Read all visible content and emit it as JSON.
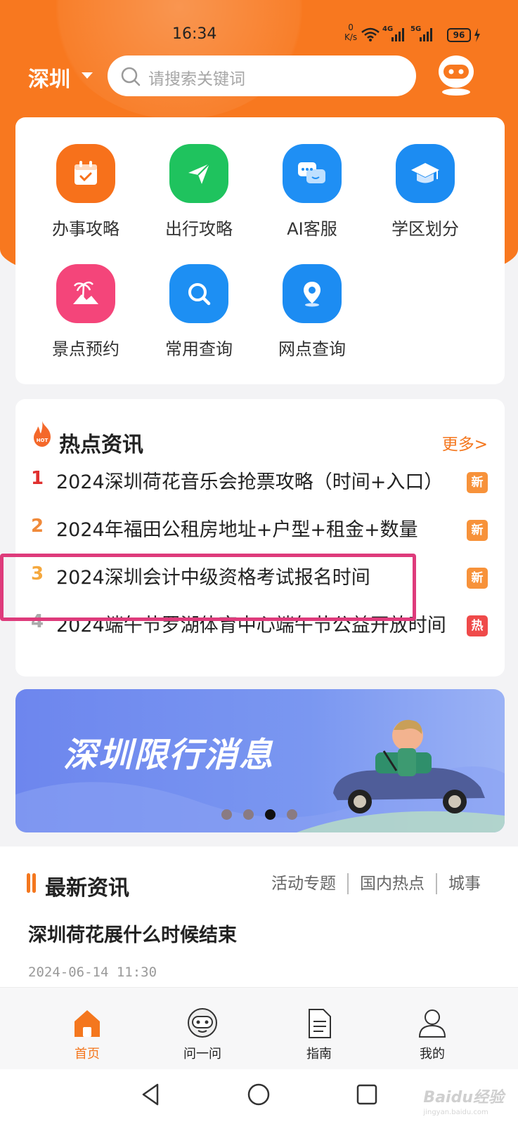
{
  "status_bar": {
    "time": "16:34",
    "net_speed_value": "0",
    "net_speed_unit": "K/s",
    "signal1": "4G",
    "signal2": "5G",
    "battery": "96"
  },
  "header": {
    "city": "深圳",
    "search_placeholder": "请搜索关键词"
  },
  "services": [
    {
      "label": "办事攻略",
      "icon": "calendar-icon",
      "color": "#f7711b"
    },
    {
      "label": "出行攻略",
      "icon": "paper-plane-icon",
      "color": "#1fc35e"
    },
    {
      "label": "AI客服",
      "icon": "chat-bubbles-icon",
      "color": "#1f8ff4"
    },
    {
      "label": "学区划分",
      "icon": "graduation-cap-icon",
      "color": "#1c8cf2"
    },
    {
      "label": "景点预约",
      "icon": "palm-tree-icon",
      "color": "#f4457a"
    },
    {
      "label": "常用查询",
      "icon": "magnifier-icon",
      "color": "#1d8ff3"
    },
    {
      "label": "网点查询",
      "icon": "location-pin-icon",
      "color": "#1c8cf2"
    }
  ],
  "hot_news": {
    "title": "热点资讯",
    "more": "更多>",
    "items": [
      {
        "rank": "1",
        "text": "2024深圳荷花音乐会抢票攻略（时间+入口）",
        "badge": "新",
        "rank_color": "#e0302f",
        "badge_color": "#f7923a"
      },
      {
        "rank": "2",
        "text": "2024年福田公租房地址+户型+租金+数量",
        "badge": "新",
        "rank_color": "#f08a3a",
        "badge_color": "#f7923a"
      },
      {
        "rank": "3",
        "text": "2024深圳会计中级资格考试报名时间",
        "badge": "新",
        "rank_color": "#f5a83e",
        "badge_color": "#f7923a"
      },
      {
        "rank": "4",
        "text": "2024端午节罗湖体育中心端午节公益开放时间",
        "badge": "热",
        "rank_color": "#aaaaaa",
        "badge_color": "#ef4a4a"
      }
    ]
  },
  "banner": {
    "text": "深圳限行消息",
    "active_dot": 3,
    "dot_count": 4
  },
  "latest_news": {
    "title": "最新资讯",
    "tabs": [
      "活动专题",
      "国内热点",
      "城事"
    ],
    "article_title": "深圳荷花展什么时候结束",
    "article_date": "2024-06-14 11:30"
  },
  "tabbar": [
    {
      "label": "首页",
      "icon": "home-icon",
      "active": true
    },
    {
      "label": "问一问",
      "icon": "robot-icon",
      "active": false
    },
    {
      "label": "指南",
      "icon": "document-icon",
      "active": false
    },
    {
      "label": "我的",
      "icon": "user-icon",
      "active": false
    }
  ],
  "watermark": {
    "brand": "Baidu经验",
    "url": "jingyan.baidu.com"
  },
  "colors": {
    "primary": "#f8781f",
    "highlight_border": "#de3b7b"
  }
}
